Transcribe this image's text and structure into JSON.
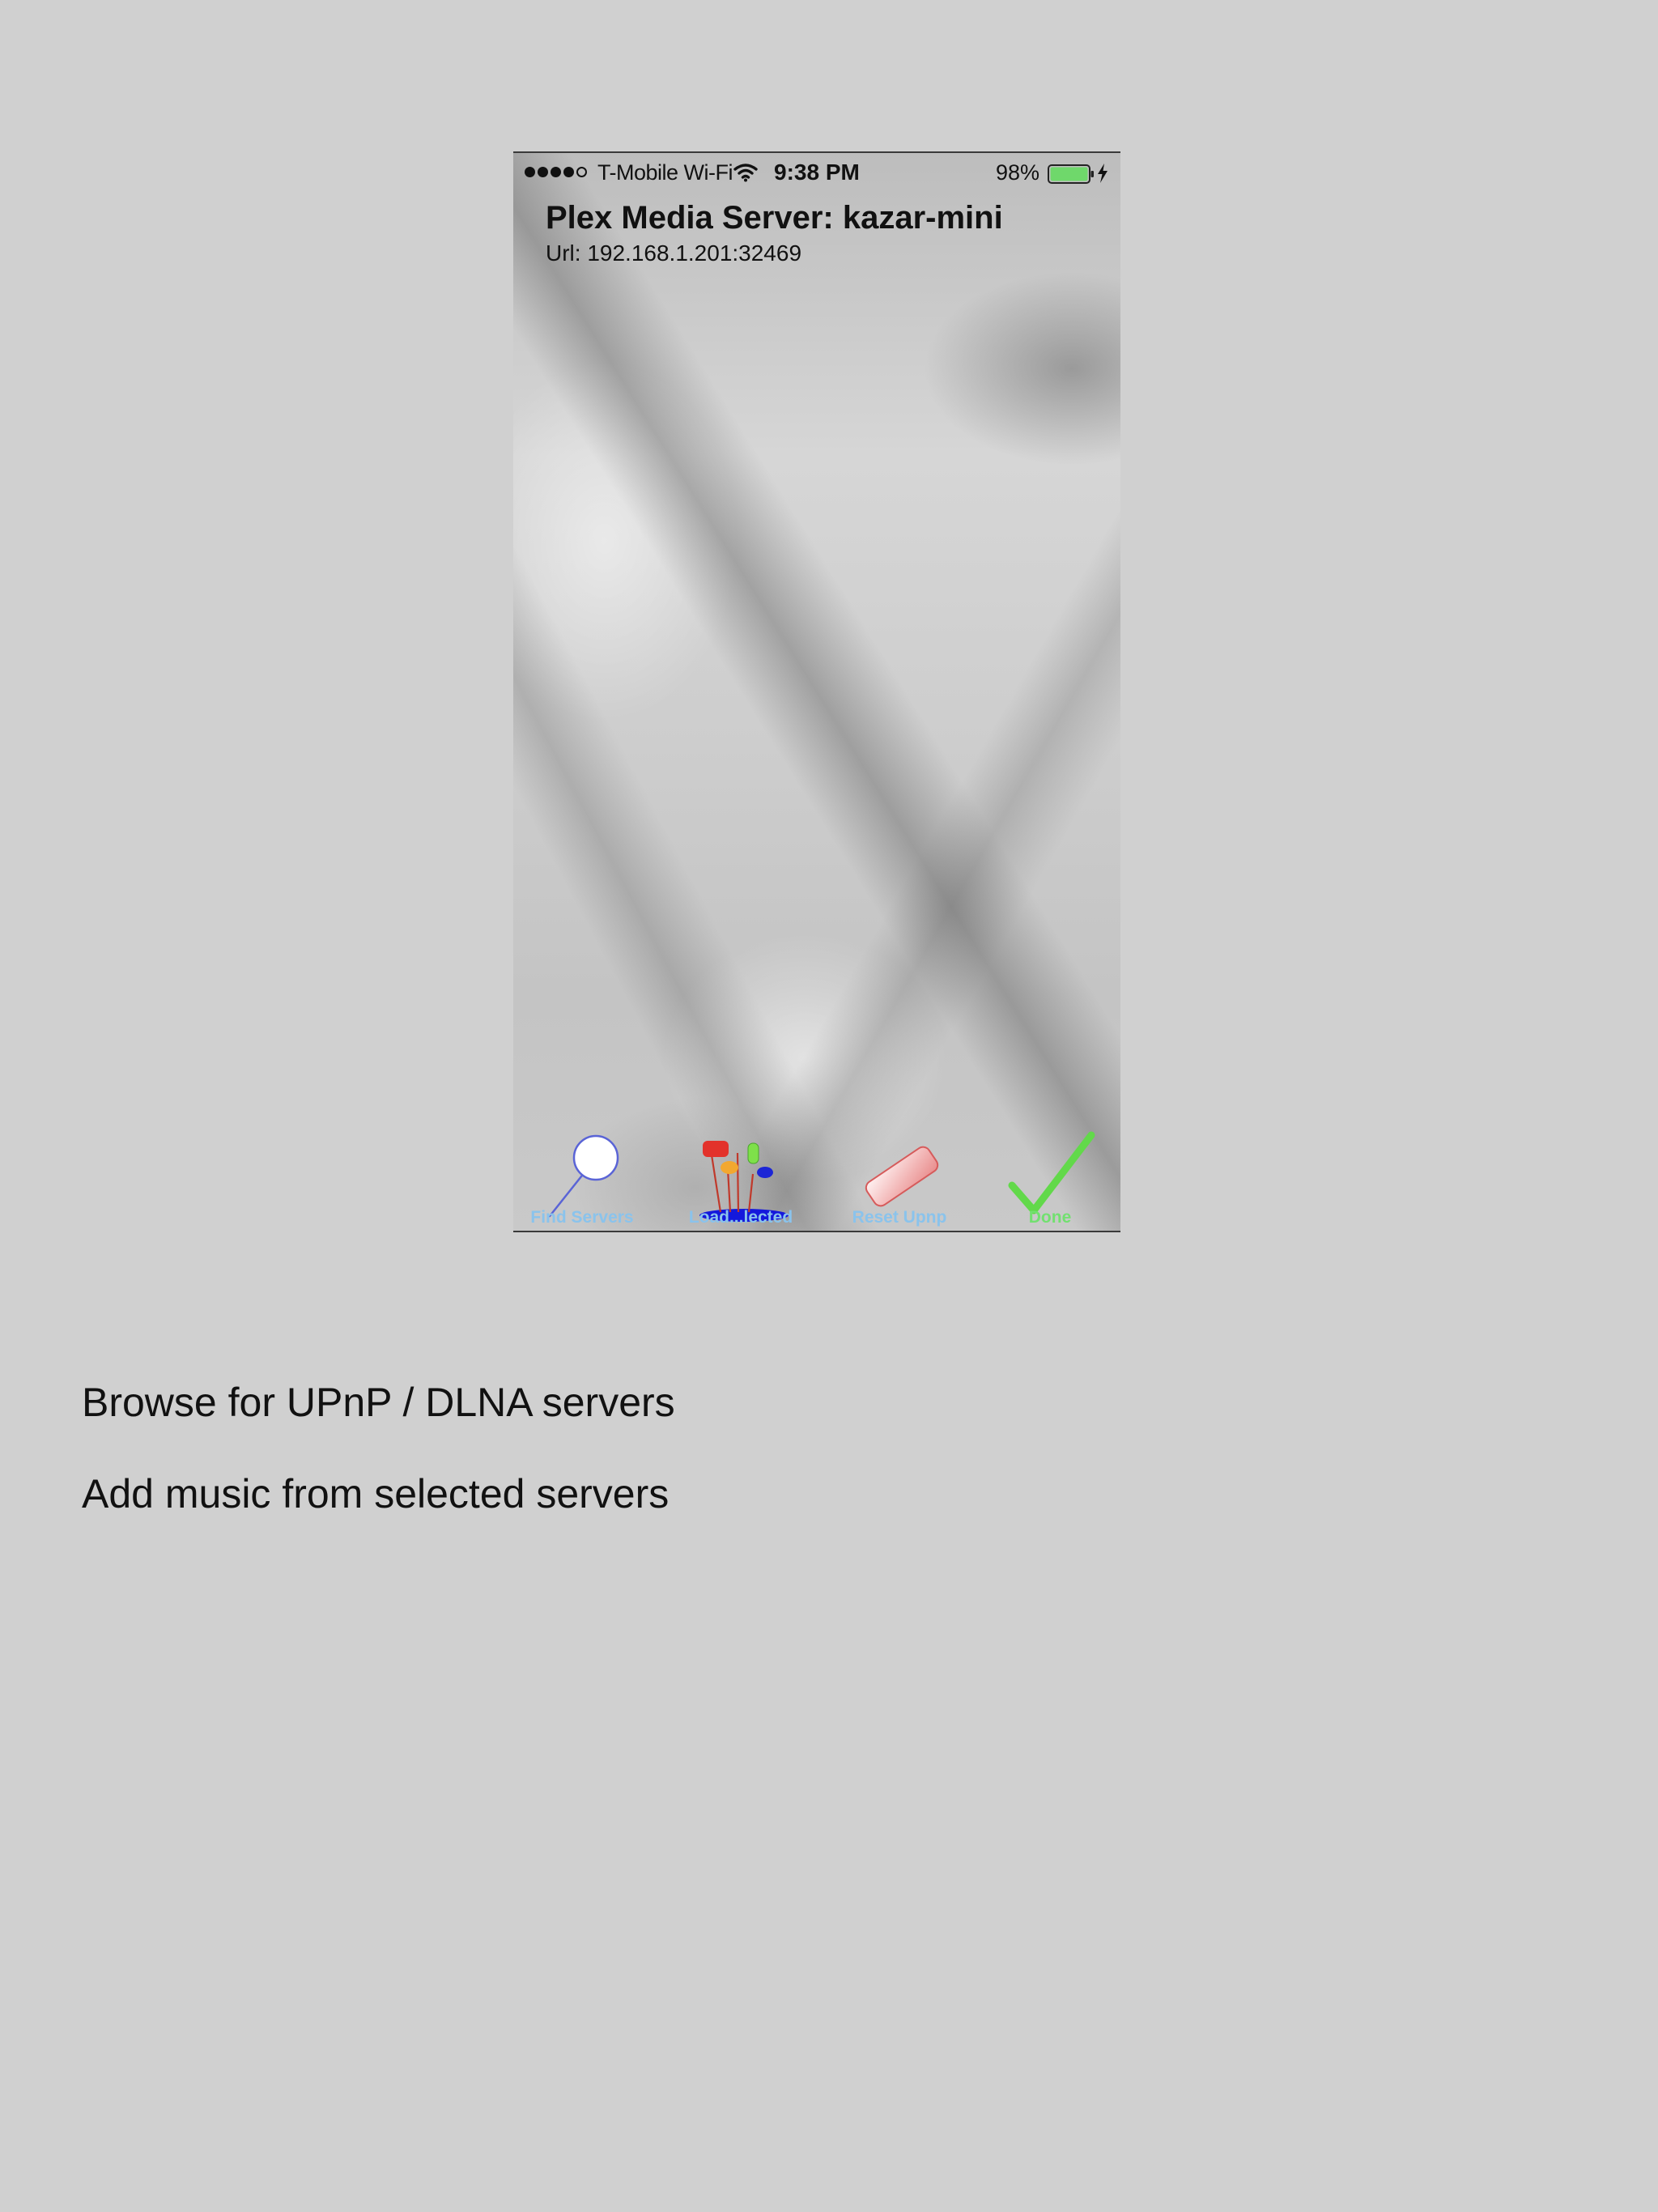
{
  "status_bar": {
    "carrier": "T-Mobile Wi-Fi",
    "time": "9:38 PM",
    "battery": "98%",
    "signal_bars": 4,
    "signal_total": 5
  },
  "header": {
    "title": "Plex Media Server: kazar-mini",
    "url": "Url: 192.168.1.201:32469"
  },
  "toolbar": {
    "items": [
      {
        "label": "Find Servers",
        "icon": "magnifier-icon"
      },
      {
        "label": "Load...lected",
        "icon": "pins-icon"
      },
      {
        "label": "Reset Upnp",
        "icon": "eraser-icon"
      },
      {
        "label": "Done",
        "icon": "checkmark-icon"
      }
    ]
  },
  "descriptions": [
    "Browse for UPnP / DLNA servers",
    "Add music from selected servers"
  ],
  "colors": {
    "page_background": "#d0d0d0",
    "toolbar_label": "#8ac3ec",
    "done_label": "#72e070",
    "battery_fill": "#6fd86b"
  }
}
